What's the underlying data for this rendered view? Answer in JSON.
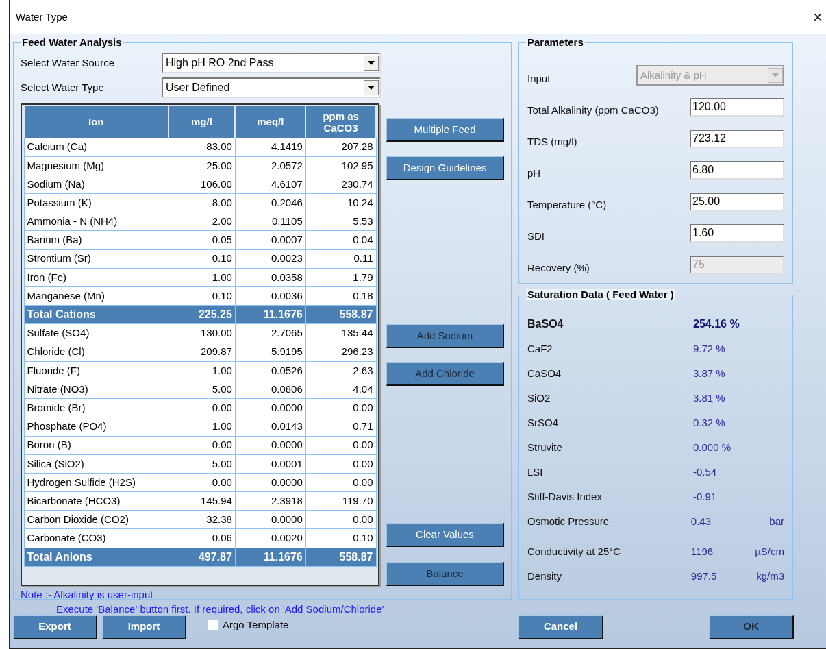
{
  "window": {
    "title": "Water Type",
    "close": "×"
  },
  "feed_water_analysis": {
    "title": "Feed Water Analysis",
    "selects": [
      {
        "label": "Select Water Source",
        "value": "High pH RO 2nd Pass"
      },
      {
        "label": "Select Water Type",
        "value": "User Defined"
      }
    ],
    "table": {
      "columns": [
        "Ion",
        "mg/l",
        "meq/l",
        "ppm as CaCO3"
      ],
      "rows": [
        {
          "kind": "ion",
          "cells": [
            "Calcium (Ca)",
            "83.00",
            "4.1419",
            "207.28"
          ]
        },
        {
          "kind": "ion",
          "cells": [
            "Magnesium (Mg)",
            "25.00",
            "2.0572",
            "102.95"
          ]
        },
        {
          "kind": "ion",
          "cells": [
            "Sodium (Na)",
            "106.00",
            "4.6107",
            "230.74"
          ]
        },
        {
          "kind": "ion",
          "cells": [
            "Potassium (K)",
            "8.00",
            "0.2046",
            "10.24"
          ]
        },
        {
          "kind": "ion",
          "cells": [
            "Ammonia - N (NH4)",
            "2.00",
            "0.1105",
            "5.53"
          ]
        },
        {
          "kind": "ion",
          "cells": [
            "Barium (Ba)",
            "0.05",
            "0.0007",
            "0.04"
          ]
        },
        {
          "kind": "ion",
          "cells": [
            "Strontium (Sr)",
            "0.10",
            "0.0023",
            "0.11"
          ]
        },
        {
          "kind": "ion",
          "cells": [
            "Iron (Fe)",
            "1.00",
            "0.0358",
            "1.79"
          ]
        },
        {
          "kind": "ion",
          "cells": [
            "Manganese (Mn)",
            "0.10",
            "0.0036",
            "0.18"
          ]
        },
        {
          "kind": "total",
          "cells": [
            "Total Cations",
            "225.25",
            "11.1676",
            "558.87"
          ]
        },
        {
          "kind": "ion",
          "cells": [
            "Sulfate (SO4)",
            "130.00",
            "2.7065",
            "135.44"
          ]
        },
        {
          "kind": "ion",
          "cells": [
            "Chloride (Cl)",
            "209.87",
            "5.9195",
            "296.23"
          ]
        },
        {
          "kind": "ion",
          "cells": [
            "Fluoride (F)",
            "1.00",
            "0.0526",
            "2.63"
          ]
        },
        {
          "kind": "ion",
          "cells": [
            "Nitrate (NO3)",
            "5.00",
            "0.0806",
            "4.04"
          ]
        },
        {
          "kind": "ion",
          "cells": [
            "Bromide (Br)",
            "0.00",
            "0.0000",
            "0.00"
          ]
        },
        {
          "kind": "ion",
          "cells": [
            "Phosphate (PO4)",
            "1.00",
            "0.0143",
            "0.71"
          ]
        },
        {
          "kind": "ion",
          "cells": [
            "Boron (B)",
            "0.00",
            "0.0000",
            "0.00"
          ]
        },
        {
          "kind": "ion",
          "cells": [
            "Silica (SiO2)",
            "5.00",
            "0.0001",
            "0.00"
          ]
        },
        {
          "kind": "ion",
          "cells": [
            "Hydrogen Sulfide (H2S)",
            "0.00",
            "0.0000",
            "0.00"
          ]
        },
        {
          "kind": "ion",
          "cells": [
            "Bicarbonate (HCO3)",
            "145.94",
            "2.3918",
            "119.70"
          ]
        },
        {
          "kind": "ion",
          "cells": [
            "Carbon Dioxide (CO2)",
            "32.38",
            "0.0000",
            "0.00"
          ]
        },
        {
          "kind": "ion",
          "cells": [
            "Carbonate (CO3)",
            "0.06",
            "0.0020",
            "0.10"
          ]
        },
        {
          "kind": "total",
          "cells": [
            "Total Anions",
            "497.87",
            "11.1676",
            "558.87"
          ]
        }
      ]
    },
    "side_buttons": [
      {
        "label": "Multiple Feed",
        "disabled": false
      },
      {
        "label": "Design Guidelines",
        "disabled": false
      },
      {
        "label": "Add Sodium",
        "disabled": true
      },
      {
        "label": "Add Chloride",
        "disabled": true
      },
      {
        "label": "Clear Values",
        "disabled": false
      },
      {
        "label": "Balance",
        "disabled": true
      }
    ],
    "note": [
      "Note :- Alkalinity is user-input",
      "Execute 'Balance' button first. If required, click on 'Add Sodium/Chloride'"
    ]
  },
  "parameters": {
    "title": "Parameters",
    "fields": [
      {
        "kind": "select",
        "label": "Input",
        "value": "Alkalinity & pH",
        "disabled": true
      },
      {
        "kind": "text",
        "label": "Total Alkalinity (ppm CaCO3)",
        "value": "120.00",
        "disabled": false
      },
      {
        "kind": "text",
        "label": "TDS (mg/l)",
        "value": "723.12",
        "disabled": false
      },
      {
        "kind": "text",
        "label": "pH",
        "value": "6.80",
        "disabled": false
      },
      {
        "kind": "text",
        "label": "Temperature (°C)",
        "value": "25.00",
        "disabled": false
      },
      {
        "kind": "text",
        "label": "SDI",
        "value": "1.60",
        "disabled": false
      },
      {
        "kind": "text",
        "label": "Recovery (%)",
        "value": "75",
        "disabled": true
      }
    ]
  },
  "saturation_data": {
    "title": "Saturation Data ( Feed Water )",
    "items": [
      {
        "label": "BaSO4",
        "value": "254.16 %",
        "bold": true
      },
      {
        "label": "CaF2",
        "value": "9.72 %",
        "bold": false
      },
      {
        "label": "CaSO4",
        "value": "3.87 %",
        "bold": false
      },
      {
        "label": "SiO2",
        "value": "3.81 %",
        "bold": false
      },
      {
        "label": "SrSO4",
        "value": "0.32 %",
        "bold": false
      },
      {
        "label": "Struvite",
        "value": "0.000 %",
        "bold": false
      },
      {
        "label": "LSI",
        "value": "-0.54",
        "bold": false
      },
      {
        "label": "Stiff-Davis Index",
        "value": "-0.91",
        "bold": false
      },
      {
        "label": "Osmotic Pressure",
        "value": "0.43",
        "unit": "bar",
        "bold": false
      },
      {
        "label": "Conductivity at 25°C",
        "value": "1196",
        "unit": "µS/cm",
        "bold": false
      },
      {
        "label": "Density",
        "value": "997.5",
        "unit": "kg/m3",
        "bold": false
      }
    ]
  },
  "footer": {
    "left_buttons": [
      {
        "label": "Export",
        "disabled": false
      },
      {
        "label": "Import",
        "disabled": false
      }
    ],
    "checkbox": {
      "label": "Argo Template",
      "checked": false
    },
    "right_buttons": [
      {
        "label": "Cancel",
        "disabled": false
      },
      {
        "label": "OK",
        "disabled": true
      }
    ]
  }
}
